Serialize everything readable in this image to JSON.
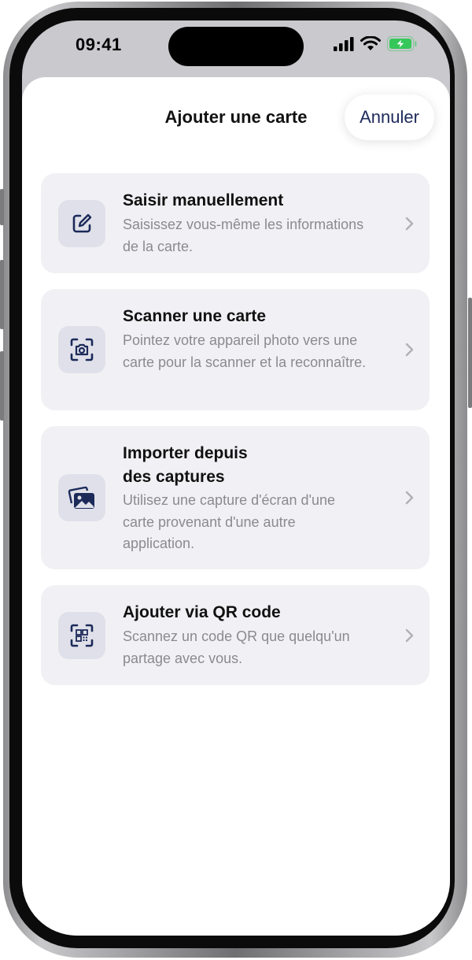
{
  "status": {
    "time": "09:41"
  },
  "sheet": {
    "title": "Ajouter une carte",
    "cancel_label": "Annuler"
  },
  "options": [
    {
      "title": "Saisir manuellement",
      "description": "Saisissez vous-même les informations de la carte.",
      "icon": "edit-icon"
    },
    {
      "title": "Scanner une carte",
      "description": "Pointez votre appareil photo vers une carte pour la scanner et la reconnaître.",
      "icon": "camera-scan-icon"
    },
    {
      "title": "Importer depuis des captures",
      "description": "Utilisez une capture d'écran d'une carte provenant d'une autre application.",
      "icon": "photos-icon"
    },
    {
      "title": "Ajouter via QR code",
      "description": "Scannez un code QR que quelqu'un partage avec vous.",
      "icon": "qr-scan-icon"
    }
  ],
  "colors": {
    "accent": "#1c2a5a",
    "card_bg": "#f1f1f5",
    "icon_bg": "#dfe0e9",
    "battery": "#35c759"
  }
}
